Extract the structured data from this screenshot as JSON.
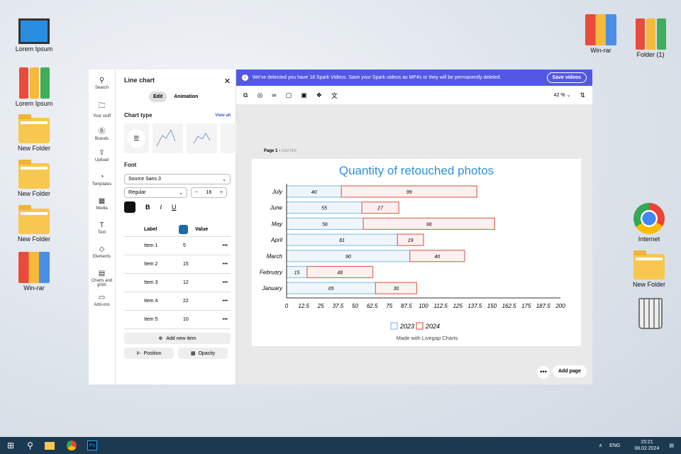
{
  "desktop": {
    "icons_left": [
      {
        "label": "Lorem Ipsum",
        "type": "computer"
      },
      {
        "label": "Lorem Ipsum",
        "type": "books"
      },
      {
        "label": "New Folder",
        "type": "folder"
      },
      {
        "label": "New Folder",
        "type": "folder"
      },
      {
        "label": "New Folder",
        "type": "folder"
      },
      {
        "label": "Win-rar",
        "type": "rar"
      }
    ],
    "icons_right": [
      {
        "label": "Win-rar"
      },
      {
        "label": "Folder (1)"
      },
      {
        "label": "Internet"
      },
      {
        "label": "New Folder"
      }
    ]
  },
  "rail": [
    "Search",
    "Your stuff",
    "Brands",
    "Upload",
    "Templates",
    "Media",
    "Text",
    "Elements",
    "Charts and grids",
    "Add-ons"
  ],
  "editor": {
    "title": "Line chart",
    "tab_edit": "Edit",
    "tab_animation": "Animation",
    "chart_type": "Chart type",
    "view_all": "View all",
    "font_label": "Font",
    "font": "Source Sans 3",
    "weight": "Regular",
    "size": "16",
    "bold": "B",
    "italic": "I",
    "underline": "U",
    "label_col": "Label",
    "value_col": "Value",
    "color": "#1f6aa5",
    "items": [
      {
        "label": "Item 1",
        "value": "5"
      },
      {
        "label": "Item 2",
        "value": "15"
      },
      {
        "label": "Item 3",
        "value": "12"
      },
      {
        "label": "Item 4",
        "value": "22"
      },
      {
        "label": "Item 5",
        "value": "10"
      }
    ],
    "add_item": "Add new item",
    "position": "Position",
    "opacity": "Opacity"
  },
  "banner": {
    "text": "We've detected you have 18 Spark Videos. Save your Spark videos as MP4s or they will be permanently deleted.",
    "button": "Save videos",
    "color": "#5258e4"
  },
  "toolbar": {
    "zoom": "42 %"
  },
  "page": {
    "label": "Page 1 -",
    "add_title": "Add title"
  },
  "add_page": "Add page",
  "chart_data": {
    "type": "bar",
    "orientation": "horizontal",
    "stacked": true,
    "title": "Quantity of retouched photos",
    "categories": [
      "July",
      "June",
      "May",
      "April",
      "March",
      "February",
      "January"
    ],
    "series": [
      {
        "name": "2023",
        "values": [
          40,
          55,
          56,
          81,
          90,
          15,
          65
        ],
        "color": "#8ec5ea"
      },
      {
        "name": "2024",
        "values": [
          99,
          27,
          96,
          19,
          40,
          48,
          30
        ],
        "color": "#e06a5e"
      }
    ],
    "xlim": [
      0,
      200
    ],
    "xticks": [
      "0",
      "12.5",
      "25",
      "37.5",
      "50",
      "62.5",
      "75",
      "87.5",
      "100",
      "112.5",
      "125",
      "137.5",
      "150",
      "162.5",
      "175",
      "187.5",
      "200"
    ],
    "legend": "bottom",
    "credit": "Made with Livegap Charts"
  },
  "taskbar": {
    "lang": "ENG",
    "time": "15:21",
    "date": "08.02.2024"
  }
}
